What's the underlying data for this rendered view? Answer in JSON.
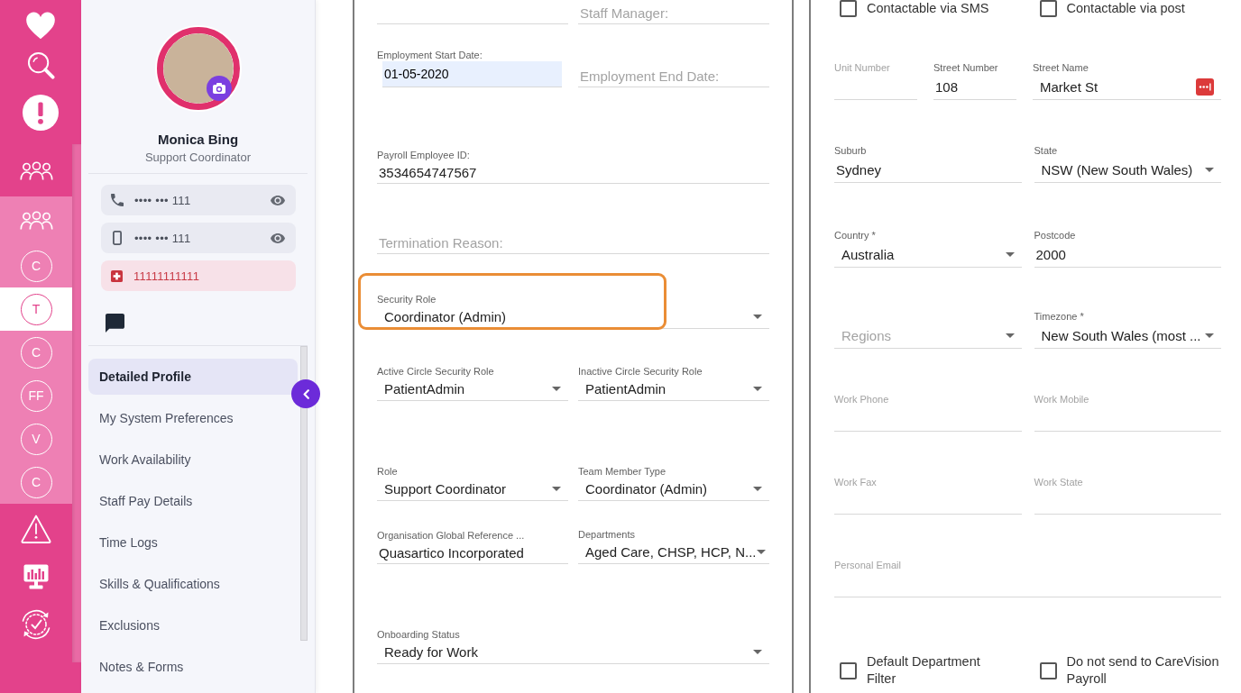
{
  "rail": {
    "initials": [
      {
        "text": "C",
        "selected": false
      },
      {
        "text": "T",
        "selected": true
      },
      {
        "text": "C",
        "selected": false
      },
      {
        "text": "FF",
        "selected": false
      },
      {
        "text": "V",
        "selected": false
      },
      {
        "text": "C",
        "selected": false
      }
    ]
  },
  "profile": {
    "name": "Monica Bing",
    "role": "Support Coordinator",
    "contacts": [
      {
        "kind": "phone",
        "value": "•••• ••• 111",
        "masked": true
      },
      {
        "kind": "mobile",
        "value": "•••• ••• 111",
        "masked": true
      },
      {
        "kind": "emergency",
        "value": "11111111111",
        "masked": false
      }
    ]
  },
  "menu": [
    {
      "label": "Detailed Profile",
      "selected": true
    },
    {
      "label": "My System Preferences",
      "selected": false
    },
    {
      "label": "Work Availability",
      "selected": false
    },
    {
      "label": "Staff Pay Details",
      "selected": false
    },
    {
      "label": "Time Logs",
      "selected": false
    },
    {
      "label": "Skills & Qualifications",
      "selected": false
    },
    {
      "label": "Exclusions",
      "selected": false
    },
    {
      "label": "Notes & Forms",
      "selected": false
    }
  ],
  "employment_panel": {
    "rows": [
      {
        "fields": [
          {
            "kind": "text",
            "highlighted": false,
            "autofilled": false
          },
          {
            "kind": "text",
            "placeholder": "Staff Manager:",
            "highlighted": false,
            "autofilled": false
          }
        ]
      },
      {
        "fields": [
          {
            "kind": "text",
            "label": "Employment Start Date:",
            "value": "01-05-2020",
            "highlighted": false,
            "autofilled": true
          },
          {
            "kind": "text",
            "placeholder": "Employment End Date:",
            "highlighted": false,
            "autofilled": false
          }
        ]
      },
      {
        "fields": [
          {
            "kind": "text",
            "label": "Payroll Employee ID:",
            "value": "3534654747567",
            "highlighted": false,
            "autofilled": false
          }
        ]
      },
      {
        "fields": [
          {
            "kind": "text",
            "placeholder": "Termination Reason:",
            "highlighted": false,
            "autofilled": false
          }
        ]
      },
      {
        "fields": [
          {
            "kind": "select",
            "label": "Security Role",
            "value": "Coordinator (Admin)",
            "highlighted": true,
            "autofilled": false
          }
        ]
      },
      {
        "fields": [
          {
            "kind": "select",
            "label": "Active Circle Security Role",
            "value": "PatientAdmin",
            "highlighted": false,
            "autofilled": false
          },
          {
            "kind": "select",
            "label": "Inactive Circle Security Role",
            "value": "PatientAdmin",
            "highlighted": false,
            "autofilled": false
          }
        ]
      },
      {
        "fields": [
          {
            "kind": "select",
            "label": "Role",
            "value": "Support Coordinator",
            "highlighted": false,
            "autofilled": false
          },
          {
            "kind": "select",
            "label": "Team Member Type",
            "value": "Coordinator (Admin)",
            "highlighted": false,
            "autofilled": false
          }
        ]
      },
      {
        "fields": [
          {
            "kind": "text",
            "label": "Organisation Global Reference ...",
            "value": "Quasartico Incorporated",
            "highlighted": false,
            "autofilled": false
          },
          {
            "kind": "select",
            "label": "Departments",
            "value": "Aged Care, CHSP, HCP, N...",
            "highlighted": false,
            "autofilled": false
          }
        ]
      },
      {
        "fields": [
          {
            "kind": "select",
            "label": "Onboarding Status",
            "value": "Ready for Work",
            "highlighted": false,
            "autofilled": false
          }
        ]
      }
    ]
  },
  "address_panel": {
    "rows": [
      {
        "fields": [
          {
            "kind": "checkbox",
            "label": "Contactable via SMS",
            "checked": false
          },
          {
            "kind": "checkbox",
            "label": "Contactable via post",
            "checked": false
          }
        ]
      },
      {
        "fields": [
          {
            "kind": "text",
            "label": "Unit Number"
          },
          {
            "kind": "text",
            "label": "Street Number",
            "value": "108"
          },
          {
            "kind": "lookup",
            "label": "Street Name",
            "value": "Market St"
          }
        ]
      },
      {
        "fields": [
          {
            "kind": "text",
            "label": "Suburb",
            "value": "Sydney"
          },
          {
            "kind": "select",
            "label": "State",
            "value": "NSW (New South Wales)"
          }
        ]
      },
      {
        "fields": [
          {
            "kind": "select",
            "label": "Country *",
            "value": "Australia"
          },
          {
            "kind": "text",
            "label": "Postcode",
            "value": "2000"
          }
        ]
      },
      {
        "fields": [
          {
            "kind": "select",
            "placeholder": "Regions"
          },
          {
            "kind": "select",
            "label": "Timezone *",
            "value": "New South Wales (most ..."
          }
        ]
      },
      {
        "fields": [
          {
            "kind": "text",
            "label": "Work Phone"
          },
          {
            "kind": "text",
            "label": "Work Mobile"
          }
        ]
      },
      {
        "fields": [
          {
            "kind": "text",
            "label": "Work Fax"
          },
          {
            "kind": "text",
            "label": "Work State"
          }
        ]
      },
      {
        "fields": [
          {
            "kind": "text",
            "label": "Personal Email"
          }
        ]
      },
      {
        "fields": [
          {
            "kind": "checkbox",
            "label": "Default Department Filter",
            "checked": false
          },
          {
            "kind": "checkbox",
            "label": "Do not send to CareVision Payroll",
            "checked": false
          }
        ]
      }
    ]
  }
}
